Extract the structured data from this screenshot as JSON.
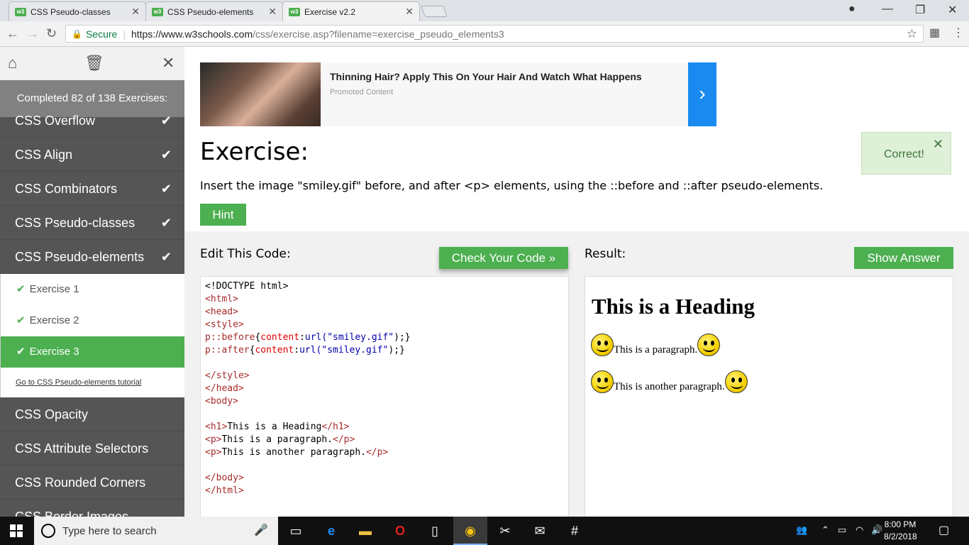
{
  "browser": {
    "tabs": [
      {
        "label": "CSS Pseudo-classes",
        "favicon": "w3"
      },
      {
        "label": "CSS Pseudo-elements",
        "favicon": "w3"
      },
      {
        "label": "Exercise v2.2",
        "favicon": "w3"
      }
    ],
    "secure_label": "Secure",
    "url_host": "https://www.w3schools.com",
    "url_path": "/css/exercise.asp?filename=exercise_pseudo_elements3"
  },
  "sidebar": {
    "completed": "Completed 82 of 138 Exercises:",
    "items": [
      {
        "label": "CSS Overflow",
        "done": true
      },
      {
        "label": "CSS Align",
        "done": true
      },
      {
        "label": "CSS Combinators",
        "done": true
      },
      {
        "label": "CSS Pseudo-classes",
        "done": true
      },
      {
        "label": "CSS Pseudo-elements",
        "done": true
      }
    ],
    "subitems": [
      {
        "label": "Exercise 1"
      },
      {
        "label": "Exercise 2"
      },
      {
        "label": "Exercise 3"
      }
    ],
    "tutorial_link": "Go to CSS Pseudo-elements tutorial",
    "items_after": [
      {
        "label": "CSS Opacity"
      },
      {
        "label": "CSS Attribute Selectors"
      },
      {
        "label": "CSS Rounded Corners"
      },
      {
        "label": "CSS Border Images"
      }
    ]
  },
  "ad": {
    "title": "Thinning Hair? Apply This On Your Hair And Watch What Happens",
    "subtitle": "Promoted Content"
  },
  "exercise": {
    "title": "Exercise:",
    "description": "Insert the image \"smiley.gif\" before, and after <p> elements, using the ::before and ::after pseudo-elements.",
    "hint_label": "Hint",
    "correct_label": "Correct!"
  },
  "editor": {
    "label": "Edit This Code:",
    "check_label": "Check Your Code »",
    "result_label": "Result:",
    "show_answer_label": "Show Answer"
  },
  "result": {
    "heading": "This is a Heading",
    "p1": "This is a paragraph.",
    "p2": "This is another paragraph."
  },
  "taskbar": {
    "search_placeholder": "Type here to search",
    "time": "8:00 PM",
    "date": "8/2/2018"
  },
  "colors": {
    "accent": "#4CAF50",
    "sidebar": "#555555",
    "ad_arrow": "#1A8AF0"
  }
}
